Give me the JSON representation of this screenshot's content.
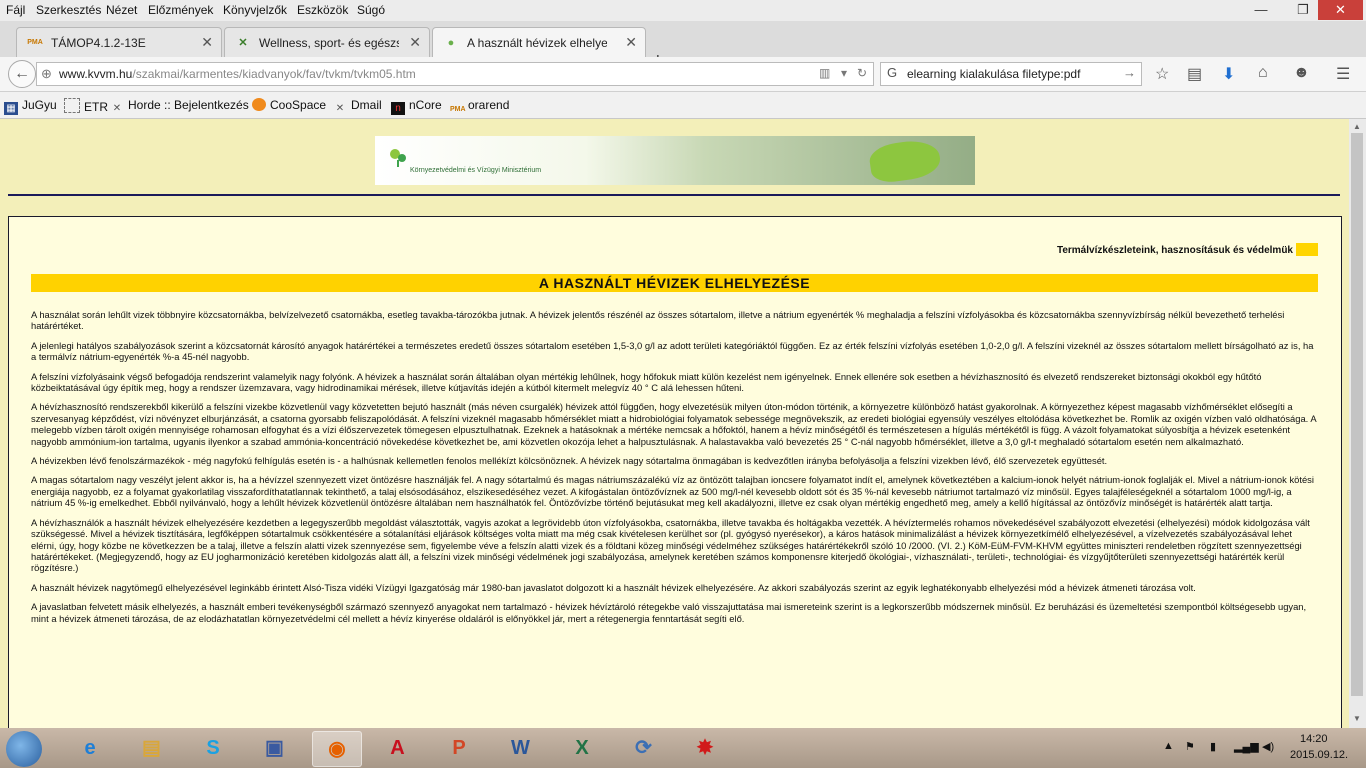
{
  "menu": [
    "Fájl",
    "Szerkesztés",
    "Nézet",
    "Előzmények",
    "Könyvjelzők",
    "Eszközök",
    "Súgó"
  ],
  "window_controls": {
    "minimize": "—",
    "restore": "❐",
    "close": "✕"
  },
  "tabs": [
    {
      "label": "TÁMOP4.1.2-13E",
      "icon": "PMA"
    },
    {
      "label": "Wellness, sport- és egészs...",
      "icon": "✕"
    },
    {
      "label": "A használt hévizek elhelye...",
      "icon": "●"
    }
  ],
  "new_tab": "+",
  "nav": {
    "back": "←",
    "url_host": "www.kvvm.hu",
    "url_path": "/szakmai/karmentes/kiadvanyok/fav/tvkm/tvkm05.htm",
    "search_value": "elearning kialakulása filetype:pdf"
  },
  "bookmarks": [
    "JuGyu",
    "ETR",
    "Horde :: Bejelentkezés",
    "CooSpace",
    "Dmail",
    "nCore",
    "orarend"
  ],
  "page": {
    "banner_text": "Környezetvédelmi és Vízügyi Minisztérium",
    "topic_link": "Termálvízkészleteink, hasznosításuk és védelmük",
    "heading": "A HASZNÁLT HÉVIZEK ELHELYEZÉSE",
    "paragraphs": [
      "A használat során lehűlt vizek többnyire közcsatornákba, belvízelvezető csatornákba, esetleg tavakba-tározókba jutnak. A hévizek jelentős részénél az összes sótartalom, illetve a nátrium egyenérték % meghaladja a felszíni vízfolyásokba és közcsatornákba szennyvízbírság nélkül bevezethető terhelési határértéket.",
      "A jelenlegi hatályos szabályozások szerint a közcsatornát károsító anyagok határértékei a természetes eredetű összes sótartalom esetében 1,5-3,0 g/l az adott területi kategóriáktól függően. Ez az érték felszíni vízfolyás esetében 1,0-2,0 g/l. A felszíni vizeknél az összes sótartalom mellett bírságolható az is, ha a termálvíz nátrium-egyenérték %-a 45-nél nagyobb.",
      "A felszíni vízfolyásaink végső befogadója rendszerint valamelyik nagy folyónk. A hévizek a használat során általában olyan mértékig lehűlnek, hogy hőfokuk miatt külön kezelést nem igényelnek. Ennek ellenére sok esetben a hévízhasznosító és elvezető rendszereket biztonsági okokból egy hűtőtó közbeiktatásával úgy építik meg, hogy a rendszer üzemzavara, vagy hidrodinamikai mérések, illetve kútjavítás idején a kútból kitermelt melegvíz 40 ° C alá lehessen hűteni.",
      "A hévízhasznosító rendszerekből kikerülő a felszíni vizekbe közvetlenül vagy közvetetten bejutó használt (más néven csurgalék) hévizek attól függően, hogy elvezetésük milyen úton-módon történik, a környezetre különböző hatást gyakorolnak. A környezethez képest magasabb vízhőmérséklet elősegíti a szervesanyag képződést, vízi növényzet elburjánzását, a csatorna gyorsabb feliszapolódását. A felszíni vizeknél magasabb hőmérséklet miatt a hidrobiológiai folyamatok sebessége megnövekszik, az eredeti biológiai egyensúly veszélyes eltolódása következhet be. Romlik az oxigén vízben való oldhatósága. A melegebb vízben tárolt oxigén mennyisége rohamosan elfogyhat és a vízi élőszervezetek tömegesen elpusztulhatnak. Ezeknek a hatásoknak a mértéke nemcsak a hőfoktól, hanem a hévíz minőségétől és természetesen a hígulás mértékétől is függ. A vázolt folyamatokat súlyosbítja a hévizek esetenként nagyobb ammónium-ion tartalma, ugyanis ilyenkor a szabad ammónia-koncentráció növekedése következhet be, ami közvetlen okozója lehet a halpusztulásnak. A halastavakba való bevezetés 25 ° C-nál nagyobb hőmérséklet, illetve a 3,0 g/l-t meghaladó sótartalom esetén nem alkalmazható.",
      "A hévizekben lévő fenolszármazékok - még nagyfokú felhígulás esetén is - a halhúsnak kellemetlen fenolos mellékízt kölcsönöznek. A hévizek nagy sótartalma önmagában is kedvezőtlen irányba befolyásolja a felszíni vizekben lévő, élő szervezetek együttesét.",
      "A magas sótartalom nagy veszélyt jelent akkor is, ha a hévízzel szennyezett vizet öntözésre használják fel. A nagy sótartalmú és magas nátriumszázalékú víz az öntözött talajban ioncsere folyamatot indít el, amelynek következtében a kalcium-ionok helyét nátrium-ionok foglalják el. Mivel a nátrium-ionok kötési energiája nagyobb, ez a folyamat gyakorlatilag visszafordíthatatlannak tekinthető, a talaj elsósodásához, elszikesedéséhez vezet. A kifogástalan öntözővíznek az 500 mg/l-nél kevesebb oldott sót és 35 %-nál kevesebb nátriumot tartalmazó víz minősül. Egyes talajféleségeknél a sótartalom 1000 mg/l-ig, a nátrium 45 %-ig emelkedhet. Ebből nyilvánvaló, hogy a lehűlt hévizek közvetlenül öntözésre általában nem használhatók fel. Öntözővízbe történő bejutásukat meg kell akadályozni, illetve ez csak olyan mértékig engedhető meg, amely a kellő hígítással az öntözővíz minőségét is határérték alatt tartja.",
      "A hévízhasználók a használt hévizek elhelyezésére kezdetben a legegyszerűbb megoldást választották, vagyis azokat a legrövidebb úton vízfolyásokba, csatornákba, illetve tavakba és holtágakba vezették. A hévíztermelés rohamos növekedésével szabályozott elvezetési (elhelyezési) módok kidolgozása vált szükségessé. Mivel a hévizek tisztítására, legfőképpen sótartalmuk csökkentésére a sótalanítási eljárások költséges volta miatt ma még csak kivételesen kerülhet sor (pl. gyógysó nyerésekor), a káros hatások minimalizálást a hévizek környezetkímélő elhelyezésével, a vízelvezetés szabályozásával lehet elérni, úgy, hogy közbe ne következzen be a talaj, illetve a felszín alatti vizek szennyezése sem, figyelembe véve a felszín alatti vizek és a földtani közeg minőségi védelméhez szükséges határértékekről szóló 10 /2000. (VI. 2.) KöM-EüM-FVM-KHVM együttes miniszteri rendeletben rögzített szennyezettségi határértékeket. (Megjegyzendő, hogy az EU jogharmonizáció keretében kidolgozás alatt áll, a felszíni vizek minőségi védelmének jogi szabályozása, amelynek keretében számos komponensre kiterjedő ökológiai-, vízhasználati-, területi-, technológiai- és vízgyűjtőterületi szennyezettségi határérték kerül rögzítésre.)",
      "A használt hévizek nagytömegű elhelyezésével leginkább érintett Alsó-Tisza vidéki Vízügyi Igazgatóság már 1980-ban javaslatot dolgozott ki a használt hévizek elhelyezésére. Az akkori szabályozás szerint az egyik leghatékonyabb elhelyezési mód a hévizek átmeneti tározása volt.",
      "A javaslatban felvetett másik elhelyezés, a használt emberi tevékenységből származó szennyező anyagokat nem tartalmazó - hévizek hévíztároló rétegekbe való visszajuttatása mai ismereteink szerint is a legkorszerűbb módszernek minősül. Ez beruházási és üzemeltetési szempontból költségesebb ugyan, mint a hévizek átmeneti tározása, de az elodázhatatlan környezetvédelmi cél mellett a hévíz kinyerése oldaláról is előnyökkel jár, mert a rétegenergia fenntartását segíti elő."
    ]
  },
  "taskbar": {
    "apps": [
      {
        "name": "internet-explorer",
        "glyph": "e",
        "color": "#1f7fd6"
      },
      {
        "name": "file-explorer",
        "glyph": "▤",
        "color": "#d9a73a"
      },
      {
        "name": "skype",
        "glyph": "S",
        "color": "#1ba1e2"
      },
      {
        "name": "save",
        "glyph": "▣",
        "color": "#3a5aa0"
      },
      {
        "name": "firefox",
        "glyph": "◉",
        "color": "#e66000"
      },
      {
        "name": "acrobat",
        "glyph": "A",
        "color": "#c8101e"
      },
      {
        "name": "powerpoint",
        "glyph": "P",
        "color": "#d24726"
      },
      {
        "name": "word",
        "glyph": "W",
        "color": "#2b579a"
      },
      {
        "name": "excel",
        "glyph": "X",
        "color": "#217346"
      },
      {
        "name": "sync",
        "glyph": "⟳",
        "color": "#3c6fb4"
      },
      {
        "name": "splash",
        "glyph": "✸",
        "color": "#d11a1a"
      }
    ],
    "time": "14:20",
    "date": "2015.09.12."
  }
}
